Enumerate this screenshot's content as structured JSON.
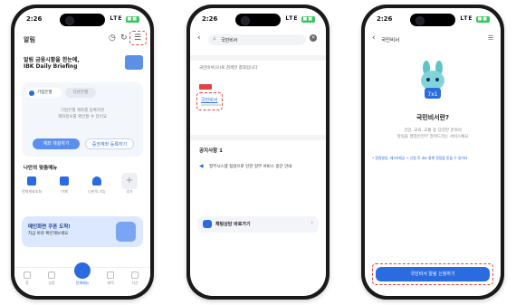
{
  "status": {
    "time": "2:26",
    "signal": "LTE"
  },
  "screen1": {
    "app_title": "알림",
    "headline_line1": "알림 금융시황을 한눈에,",
    "headline_line2": "IBK Daily Briefing",
    "tab_active": "기업은행",
    "tab_inactive": "다른은행",
    "empty_line1": "기업은행 계좌를 등록하면",
    "empty_line2": "계좌정보를 확인할 수 있어요",
    "btn_left": "계좌 개설하기",
    "btn_right": "증권계좌 등록하기",
    "my_menu_title": "나만의 맞춤메뉴",
    "menu_items": [
      "전체계좌조회",
      "이체",
      "나만의 기능",
      "추가"
    ],
    "banner_line1": "메인화면 쿠폰 도착!",
    "banner_line2": "지금 바로 확인해보세요",
    "nav_items": [
      "홈",
      "상품",
      "전체메뉴",
      "혜택",
      "자산"
    ]
  },
  "screen2": {
    "search_value": "국민비서",
    "result_hint": "국민비서(으)로 검색한 결과입니다",
    "result_item": "국민비서",
    "notice_title": "공지사항 1",
    "notice_text": "정부시스템 점검으로 인한 일부 서비스 중단 안내",
    "chat_label": "채팅상담 바로가기"
  },
  "screen3": {
    "page_title": "국민비서",
    "heading": "국민비서란?",
    "desc_line1": "건강, 교육, 교통 등 다양한 분야의",
    "desc_line2": "알림을 행정안전부 알려드리는 서비스예요",
    "link_text": "• 알림발송, 제3자제공 → 신청 후 IBK 통해 알림을 받을 수 있어요",
    "cta": "국민비서 알림 신청하기"
  },
  "colors": {
    "accent": "#2a6be0",
    "highlight": "#e0433a",
    "frame": "#1a1a1c"
  }
}
